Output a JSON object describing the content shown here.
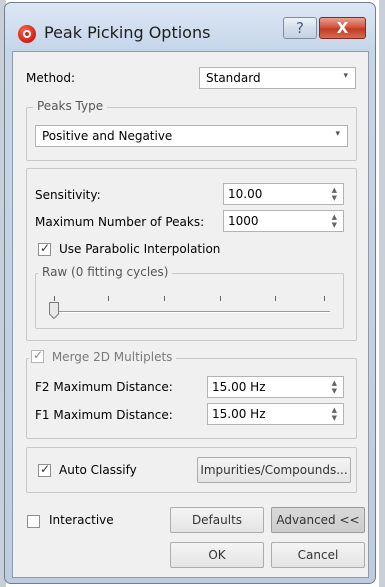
{
  "window": {
    "title": "Peak Picking Options",
    "help_glyph": "?",
    "close_glyph": "X"
  },
  "method": {
    "label": "Method:",
    "value": "Standard"
  },
  "peaks_type": {
    "group_label": "Peaks Type",
    "value": "Positive and Negative"
  },
  "sensitivity": {
    "label": "Sensitivity:",
    "value": "10.00"
  },
  "max_peaks": {
    "label": "Maximum Number of Peaks:",
    "value": "1000"
  },
  "parabolic": {
    "label": "Use Parabolic Interpolation",
    "checked": true
  },
  "raw": {
    "group_label": "Raw (0 fitting cycles)",
    "level": 0
  },
  "merge": {
    "label": "Merge 2D Multiplets",
    "checked": true
  },
  "f2": {
    "label": "F2 Maximum Distance:",
    "value": "15.00 Hz"
  },
  "f1": {
    "label": "F1 Maximum Distance:",
    "value": "15.00 Hz"
  },
  "auto_classify": {
    "label": "Auto Classify",
    "checked": true
  },
  "impurities_button": "Impurities/Compounds...",
  "interactive": {
    "label": "Interactive",
    "checked": false
  },
  "buttons": {
    "defaults": "Defaults",
    "advanced": "Advanced <<",
    "ok": "OK",
    "cancel": "Cancel"
  },
  "checkmark_glyph": "✓",
  "arrow_down_glyph": "▾",
  "spin_up_glyph": "▲",
  "spin_down_glyph": "▼"
}
